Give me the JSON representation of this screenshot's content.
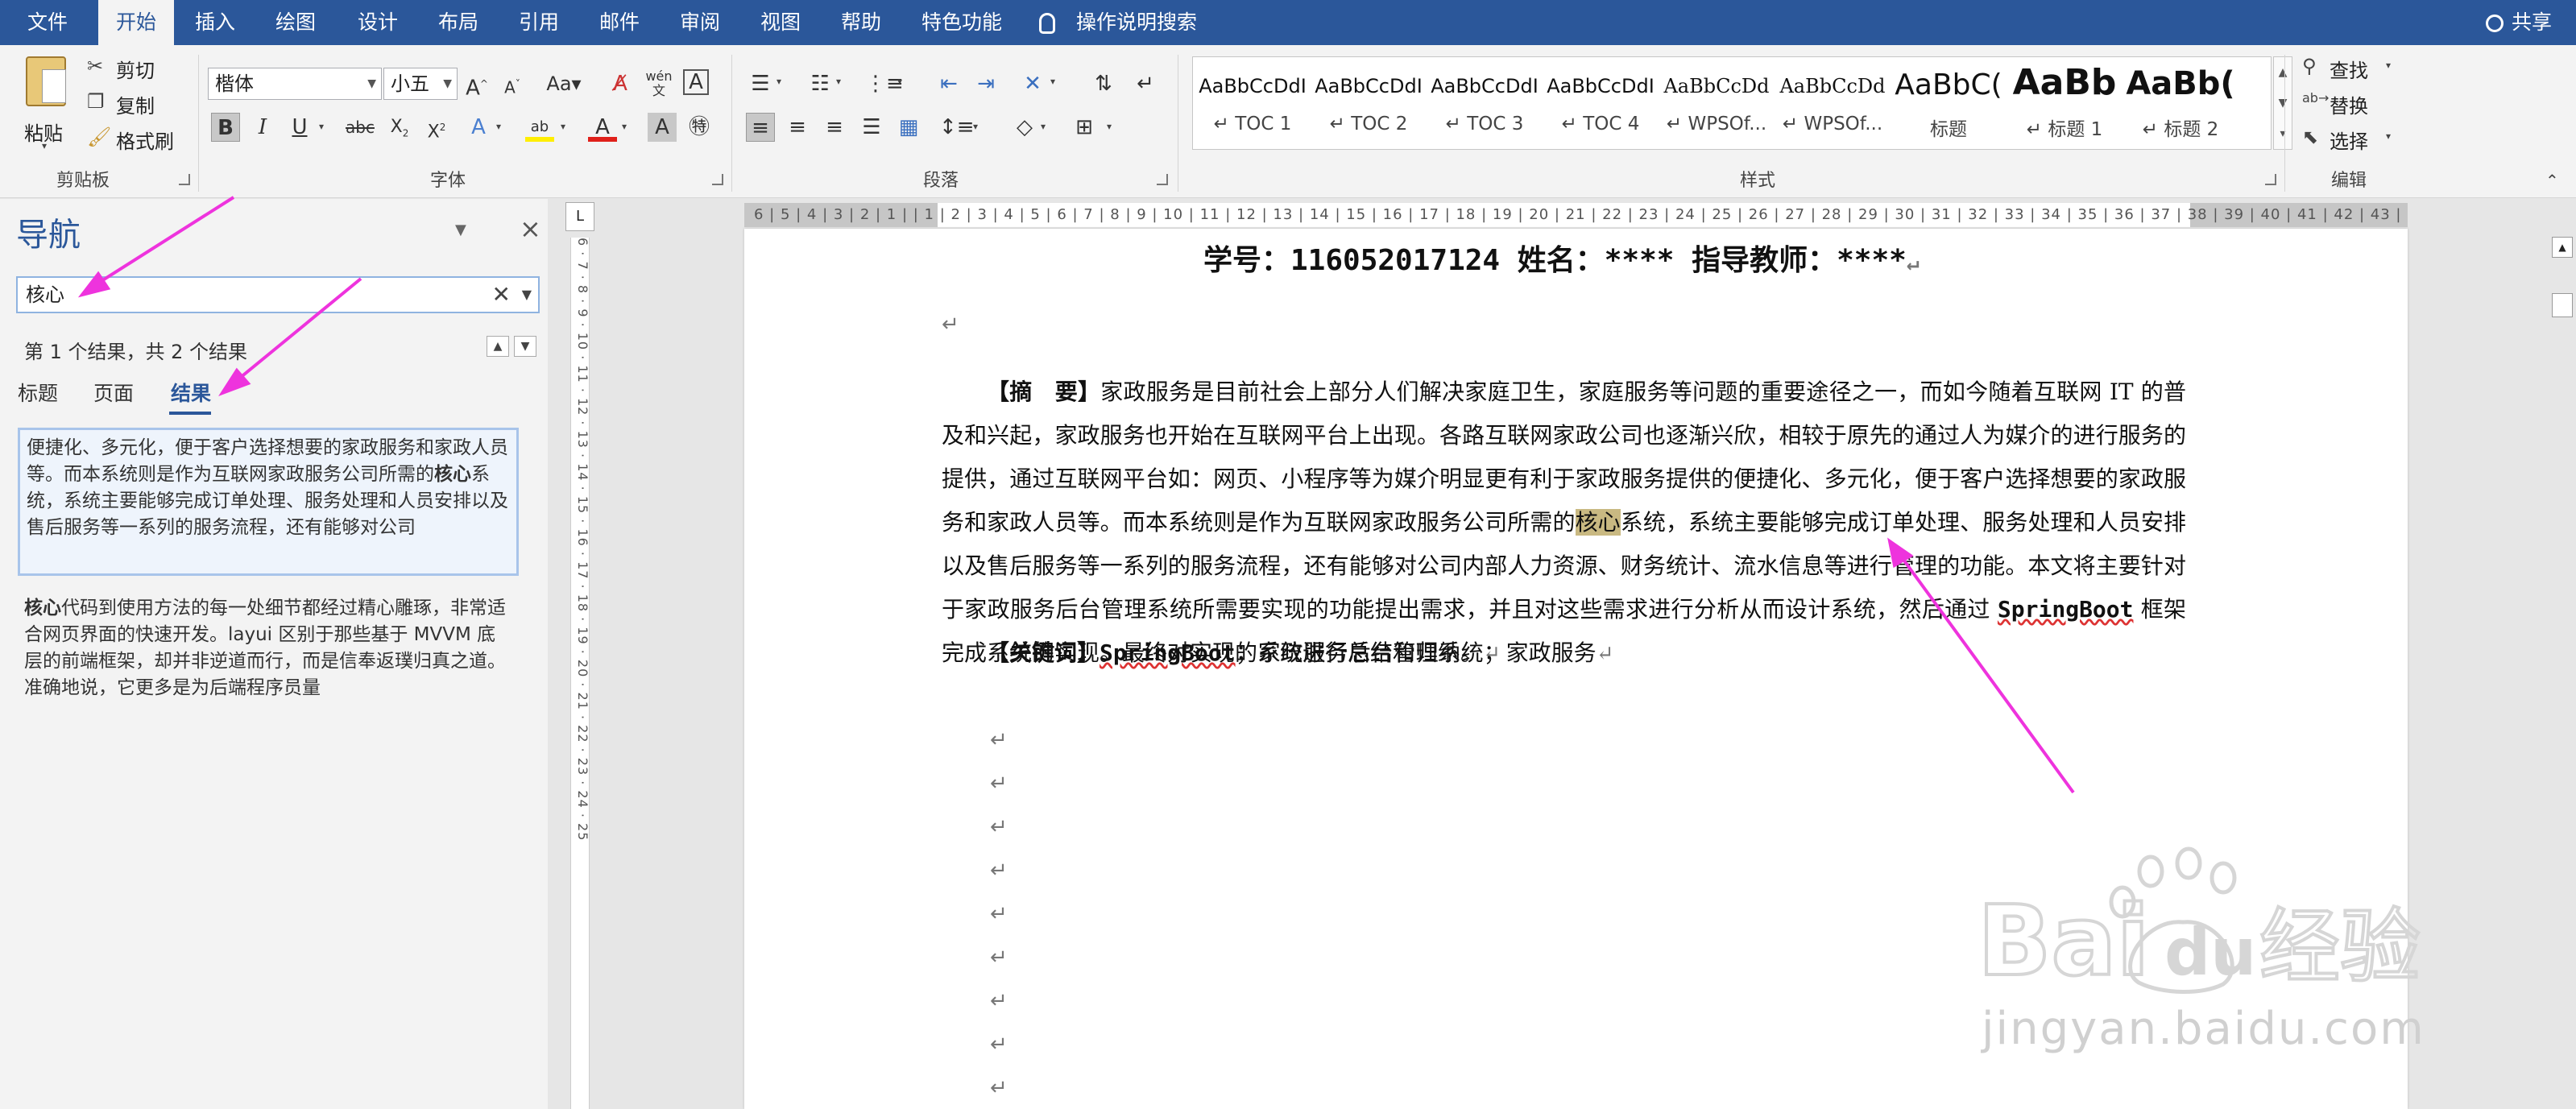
{
  "menubar": {
    "tabs": [
      "文件",
      "开始",
      "插入",
      "绘图",
      "设计",
      "布局",
      "引用",
      "邮件",
      "审阅",
      "视图",
      "帮助",
      "特色功能"
    ],
    "active_tab": "开始",
    "tell_me": "操作说明搜索",
    "share": "共享"
  },
  "ribbon": {
    "clipboard": {
      "paste": "粘贴",
      "cut": "剪切",
      "copy": "复制",
      "format_painter": "格式刷",
      "label": "剪贴板"
    },
    "font": {
      "font_name": "楷体",
      "font_size": "小五",
      "label": "字体"
    },
    "paragraph": {
      "label": "段落"
    },
    "styles": {
      "label": "样式",
      "tiles": [
        {
          "preview": "AaBbCcDdI",
          "name": "TOC 1"
        },
        {
          "preview": "AaBbCcDdI",
          "name": "TOC 2"
        },
        {
          "preview": "AaBbCcDdI",
          "name": "TOC 3"
        },
        {
          "preview": "AaBbCcDdI",
          "name": "TOC 4"
        },
        {
          "preview": "AaBbCcDd",
          "name": "WPSOf..."
        },
        {
          "preview": "AaBbCcDd",
          "name": "WPSOf..."
        },
        {
          "preview": "AaBbC(",
          "name": "标题"
        },
        {
          "preview": "AaBb",
          "name": "标题 1"
        },
        {
          "preview": "AaBb(",
          "name": "标题 2"
        }
      ]
    },
    "editing": {
      "find": "查找",
      "replace": "替换",
      "select": "选择",
      "label": "编辑"
    }
  },
  "nav": {
    "title": "导航",
    "search_value": "核心",
    "result_count": "第 1 个结果，共 2 个结果",
    "tabs": [
      "标题",
      "页面",
      "结果"
    ],
    "active_tab": "结果",
    "results": [
      {
        "before": "便捷化、多元化，便于客户选择想要的家政服务和家政人员等。而本系统则是作为互联网家政服务公司所需的",
        "match": "核心",
        "after": "系统，系统主要能够完成订单处理、服务处理和人员安排以及售后服务等一系列的服务流程，还有能够对公司"
      },
      {
        "before": "",
        "match": "核心",
        "after": "代码到使用方法的每一处细节都经过精心雕琢，非常适合网页界面的快速开发。layui 区别于那些基于 MVVM 底层的前端框架，却并非逆道而行，而是信奉返璞归真之道。准确地说，它更多是为后端程序员量"
      }
    ]
  },
  "ruler": {
    "horizontal": "6 | 5 | 4 | 3 | 2 | 1 |   | 1 | 2 | 3 | 4 | 5 | 6 | 7 | 8 | 9 | 10 | 11 | 12 | 13 | 14 | 15 | 16 | 17 | 18 | 19 | 20 | 21 | 22 | 23 | 24 | 25 | 26 | 27 | 28 | 29 | 30 | 31 | 32 | 33 | 34 | 35 | 36 | 37 | 38 | 39 | 40 | 41 | 42 | 43 | 44 | 45 | 46 | 47 | 48 | 49 |",
    "vertical": "6 · 7 · 8 · 9 · 10 · 11 · 12 · 13 · 14 · 15 · 16 · 17 · 18 · 19 · 20 · 21 · 22 · 23 · 24 · 25"
  },
  "doc": {
    "header": "学号：116052017124   姓名：****    指导教师：****",
    "abstract_label": "【摘　要】",
    "abstract_before": "家政服务是目前社会上部分人们解决家庭卫生，家庭服务等问题的重要途径之一，而如今随着互联网 IT 的普及和兴起，家政服务也开始在互联网平台上出现。各路互联网家政公司也逐渐兴欣，相较于原先的通过人为媒介的进行服务的提供，通过互联网平台如：网页、小程序等为媒介明显更有利于家政服务提供的便捷化、多元化，便于客户选择想要的家政服务和家政人员等。而本系统则是作为互联网家政服务公司所需的",
    "abstract_match": "核心",
    "abstract_after_1": "系统，系统主要能够完成订单处理、服务处理和人员安排以及售后服务等一系列的服务流程，还有能够对公司内部人力资源、财务统计、流水信息等进行管理的功能。本文将主要针对于家政服务后台管理系统所需要实现的功能提出需求，并且对这些需求进行分析从而设计系统，然后通过 ",
    "abstract_springboot": "SpringBoot",
    "abstract_after_2": " 框架完成系统的实现。最终对实现的系统进行总结和归纳。",
    "keywords_label": "【关键词】",
    "keywords_springboot": "SpringBoot",
    "keywords_rest": "；家政服务后台管理系统；家政服务"
  },
  "watermark": {
    "logo": "Bai du 经验",
    "url": "jingyan.baidu.com"
  },
  "colors": {
    "accent": "#2b579a",
    "highlight": "#c9b982",
    "arrow": "#ee33dd"
  }
}
